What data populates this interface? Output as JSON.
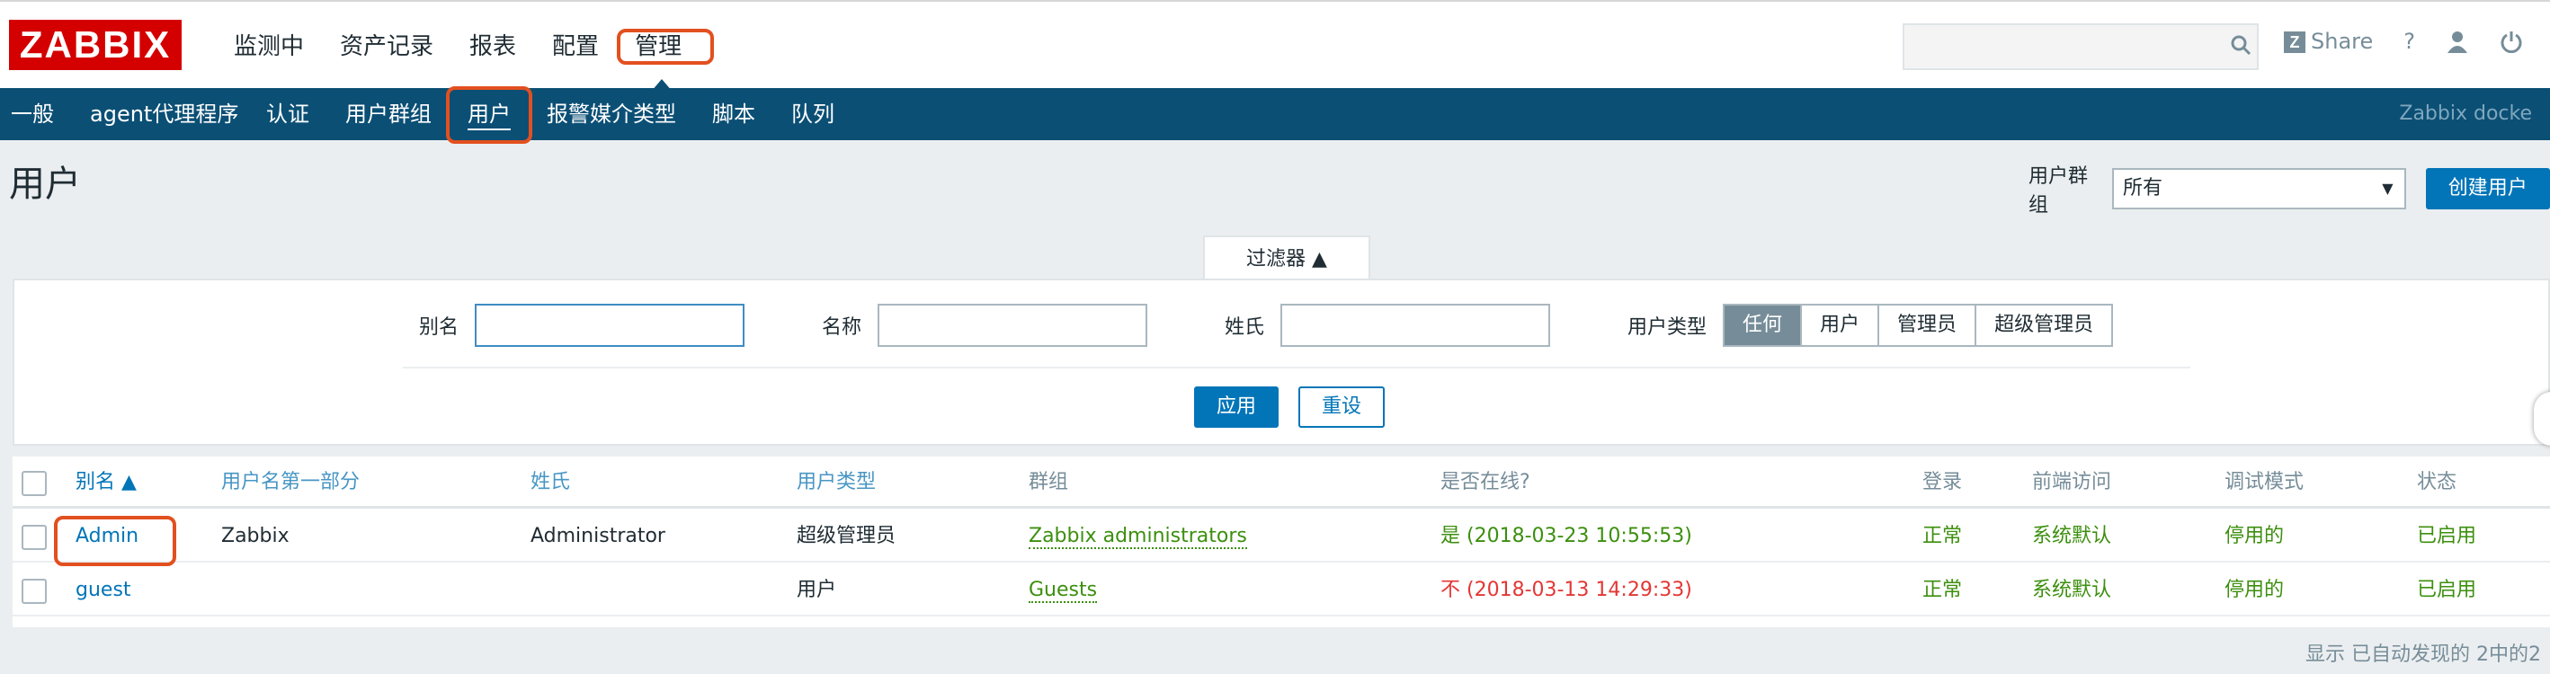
{
  "logo": "ZABBIX",
  "main_menu": [
    "监测中",
    "资产记录",
    "报表",
    "配置",
    "管理"
  ],
  "top_tools": {
    "share": "Share",
    "help": "?"
  },
  "sub_menu": [
    "一般",
    "agent代理程序",
    "认证",
    "用户群组",
    "用户",
    "报警媒介类型",
    "脚本",
    "队列"
  ],
  "brand": "Zabbix docke",
  "page_title": "用户",
  "header": {
    "group_label": "用户群组",
    "group_value": "所有",
    "create_button": "创建用户"
  },
  "filter": {
    "tab": "过滤器 ▲",
    "alias_label": "别名",
    "name_label": "名称",
    "surname_label": "姓氏",
    "type_label": "用户类型",
    "type_options": [
      "任何",
      "用户",
      "管理员",
      "超级管理员"
    ],
    "apply": "应用",
    "reset": "重设"
  },
  "table": {
    "headers": [
      "别名 ▲",
      "用户名第一部分",
      "姓氏",
      "用户类型",
      "群组",
      "是否在线?",
      "登录",
      "前端访问",
      "调试模式",
      "状态"
    ],
    "rows": [
      {
        "alias": "Admin",
        "name": "Zabbix",
        "surname": "Administrator",
        "type": "超级管理员",
        "group": "Zabbix administrators",
        "online": "是 (2018-03-23 10:55:53)",
        "login": "正常",
        "frontend": "系统默认",
        "debug": "停用的",
        "status": "已启用"
      },
      {
        "alias": "guest",
        "name": "",
        "surname": "",
        "type": "用户",
        "group": "Guests",
        "online": "不 (2018-03-13 14:29:33)",
        "login": "正常",
        "frontend": "系统默认",
        "debug": "停用的",
        "status": "已启用"
      }
    ]
  },
  "footer": "显示 已自动发现的 2中的2"
}
